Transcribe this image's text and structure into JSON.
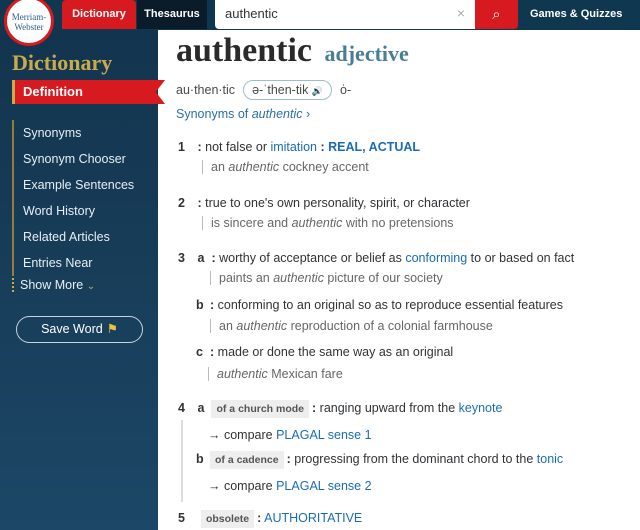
{
  "header": {
    "logo": [
      "Merriam-",
      "Webster"
    ],
    "dictionary": "Dictionary",
    "thesaurus": "Thesaurus",
    "search_value": "authentic",
    "clear": "×",
    "search_icon": "search-icon",
    "games": "Games & Quizzes"
  },
  "sidebar": {
    "title": "Dictionary",
    "active": "Definition",
    "items": [
      "Synonyms",
      "Synonym Chooser",
      "Example Sentences",
      "Word History",
      "Related Articles",
      "Entries Near"
    ],
    "show_more": "Show More",
    "save": "Save Word"
  },
  "entry": {
    "word": "authentic",
    "pos": "adjective",
    "syllables": "au·then·tic",
    "pron": "ə-ˈthen-tik",
    "pron_alt": "ȯ-",
    "syn_prefix": "Synonyms of ",
    "syn_word": "authentic"
  },
  "senses": [
    {
      "num": "1",
      "text": "not false or ",
      "link": "imitation",
      "caps": "REAL, ACTUAL",
      "ex_pre": "an ",
      "ex_it": "authentic",
      "ex_post": " cockney accent"
    },
    {
      "num": "2",
      "text": "true to one's own personality, spirit, or character",
      "ex_pre": "is sincere and ",
      "ex_it": "authentic",
      "ex_post": " with no pretensions"
    },
    {
      "num": "3",
      "letter": "a",
      "text": "worthy of acceptance or belief as ",
      "link": "conforming",
      "text2": " to or based on fact",
      "ex_pre": "paints an ",
      "ex_it": "authentic",
      "ex_post": " picture of our society"
    },
    {
      "letter": "b",
      "text": "conforming to an original so as to reproduce essential features",
      "ex_pre": "an ",
      "ex_it": "authentic",
      "ex_post": " reproduction of a colonial farmhouse"
    },
    {
      "letter": "c",
      "text": "made or done the same way as an original",
      "ex_it": "authentic",
      "ex_post": " Mexican fare"
    },
    {
      "num": "4",
      "letter": "a",
      "tag": "of a church mode",
      "text": "ranging upward from the ",
      "link": "keynote",
      "compare": "→ compare ",
      "compare_link": "PLAGAL sense 1"
    },
    {
      "letter": "b",
      "tag": "of a cadence",
      "text": "progressing from the dominant chord to the ",
      "link": "tonic",
      "compare": "→ compare ",
      "compare_link": "PLAGAL sense 2"
    },
    {
      "num": "5",
      "tag": "obsolete",
      "caps": "AUTHORITATIVE"
    }
  ],
  "colors": {
    "header": "#0f3850",
    "accent": "#d71920",
    "gold": "#c9ab4b",
    "link": "#1a6cb4"
  }
}
